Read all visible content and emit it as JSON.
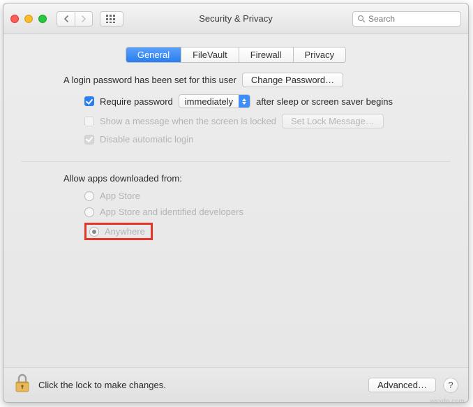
{
  "window_title": "Security & Privacy",
  "search_placeholder": "Search",
  "tabs": {
    "general": "General",
    "filevault": "FileVault",
    "firewall": "Firewall",
    "privacy": "Privacy"
  },
  "login_password_text": "A login password has been set for this user",
  "change_password_btn": "Change Password…",
  "require_password_label": "Require password",
  "require_password_value": "immediately",
  "after_sleep_text": "after sleep or screen saver begins",
  "show_message_label": "Show a message when the screen is locked",
  "set_lock_message_btn": "Set Lock Message…",
  "disable_auto_login_label": "Disable automatic login",
  "allow_apps_header": "Allow apps downloaded from:",
  "radio_app_store": "App Store",
  "radio_identified": "App Store and identified developers",
  "radio_anywhere": "Anywhere",
  "lock_text": "Click the lock to make changes.",
  "advanced_btn": "Advanced…",
  "help_label": "?",
  "watermark": "wsxdn.com"
}
